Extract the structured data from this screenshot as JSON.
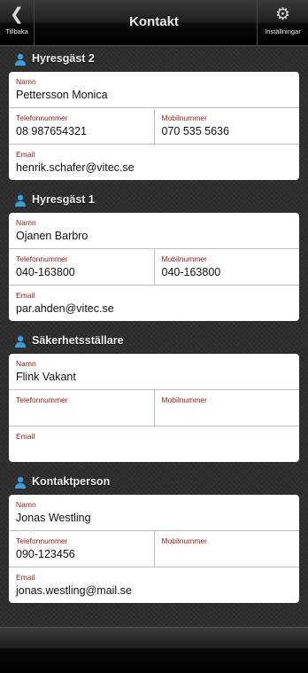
{
  "header": {
    "title": "Kontakt",
    "back_label": "Tillbaka",
    "settings_label": "Inställningar",
    "back_icon": "chevron-left-icon",
    "settings_icon": "gear-icon"
  },
  "labels": {
    "name": "Namn",
    "phone": "Telefonnummer",
    "mobile": "Mobilnummer",
    "email": "Email"
  },
  "sections": [
    {
      "title": "Hyresgäst 2",
      "name": "Pettersson Monica",
      "phone": "08 987654321",
      "mobile": "070 535 5636",
      "email": "henrik.schafer@vitec.se"
    },
    {
      "title": "Hyresgäst 1",
      "name": "Ojanen Barbro",
      "phone": "040-163800",
      "mobile": "040-163800",
      "email": "par.ahden@vitec.se"
    },
    {
      "title": "Säkerhetsställare",
      "name": "Flink Vakant",
      "phone": "",
      "mobile": "",
      "email": ""
    },
    {
      "title": "Kontaktperson",
      "name": "Jonas Westling",
      "phone": "090-123456",
      "mobile": "",
      "email": "jonas.westling@mail.se"
    }
  ],
  "colors": {
    "label": "#8b1a1a",
    "person_icon": "#3a9fd8"
  }
}
